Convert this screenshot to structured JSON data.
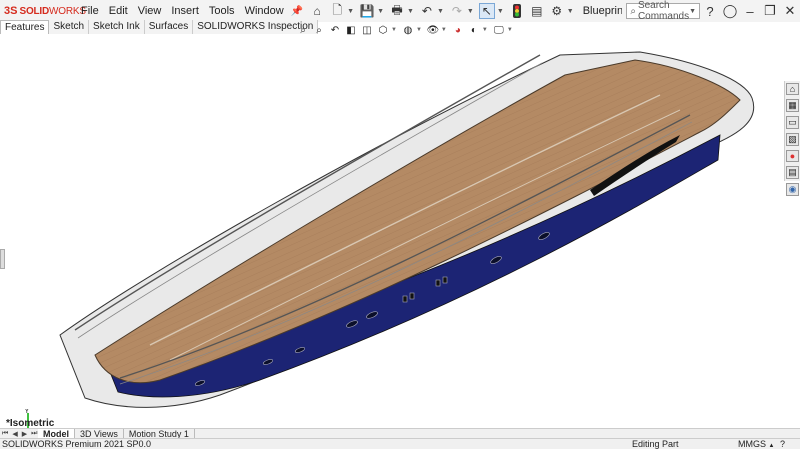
{
  "app": {
    "brand_ds": "3S",
    "brand_solid": "SOLID",
    "brand_works": "WORKS"
  },
  "menu": [
    "File",
    "Edit",
    "View",
    "Insert",
    "Tools",
    "Window"
  ],
  "document": {
    "name": "Blueprint_Setu..."
  },
  "search": {
    "placeholder": "Search Commands"
  },
  "command_tabs": [
    {
      "label": "Features",
      "active": true
    },
    {
      "label": "Sketch",
      "active": false
    },
    {
      "label": "Sketch Ink",
      "active": false
    },
    {
      "label": "Surfaces",
      "active": false
    },
    {
      "label": "SOLIDWORKS Inspection",
      "active": false
    }
  ],
  "viewport": {
    "view_name": "*Isometric"
  },
  "bottom_tabs": [
    {
      "label": "Model",
      "active": true
    },
    {
      "label": "3D Views",
      "active": false
    },
    {
      "label": "Motion Study 1",
      "active": false
    }
  ],
  "status": {
    "product": "SOLIDWORKS Premium 2021 SP0.0",
    "mode": "Editing Part",
    "units": "MMGS",
    "units_arrow": "▲",
    "help": "?"
  },
  "colors": {
    "hull_blue": "#1c2474",
    "deck_wood": "#b48a64",
    "brand_red": "#d52b1e"
  }
}
